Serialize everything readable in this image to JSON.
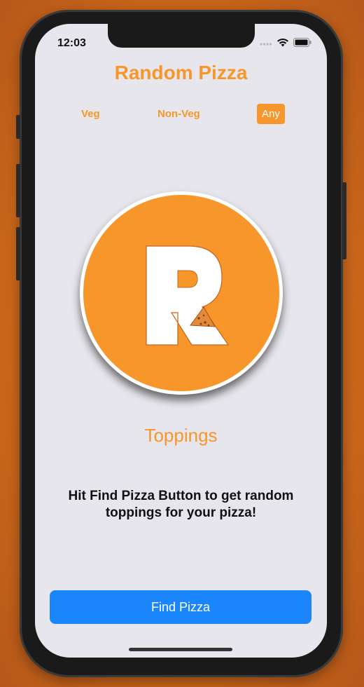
{
  "status": {
    "time": "12:03"
  },
  "header": {
    "title": "Random Pizza"
  },
  "filters": [
    {
      "label": "Veg",
      "selected": false
    },
    {
      "label": "Non-Veg",
      "selected": false
    },
    {
      "label": "Any",
      "selected": true
    }
  ],
  "logo": {
    "letter": "R"
  },
  "main": {
    "toppings_label": "Toppings",
    "hint": "Hit Find Pizza Button to get random toppings for your pizza!"
  },
  "action": {
    "find_label": "Find Pizza"
  },
  "colors": {
    "accent": "#f7962a",
    "button": "#1b86fb",
    "background": "#e7e6ec"
  }
}
